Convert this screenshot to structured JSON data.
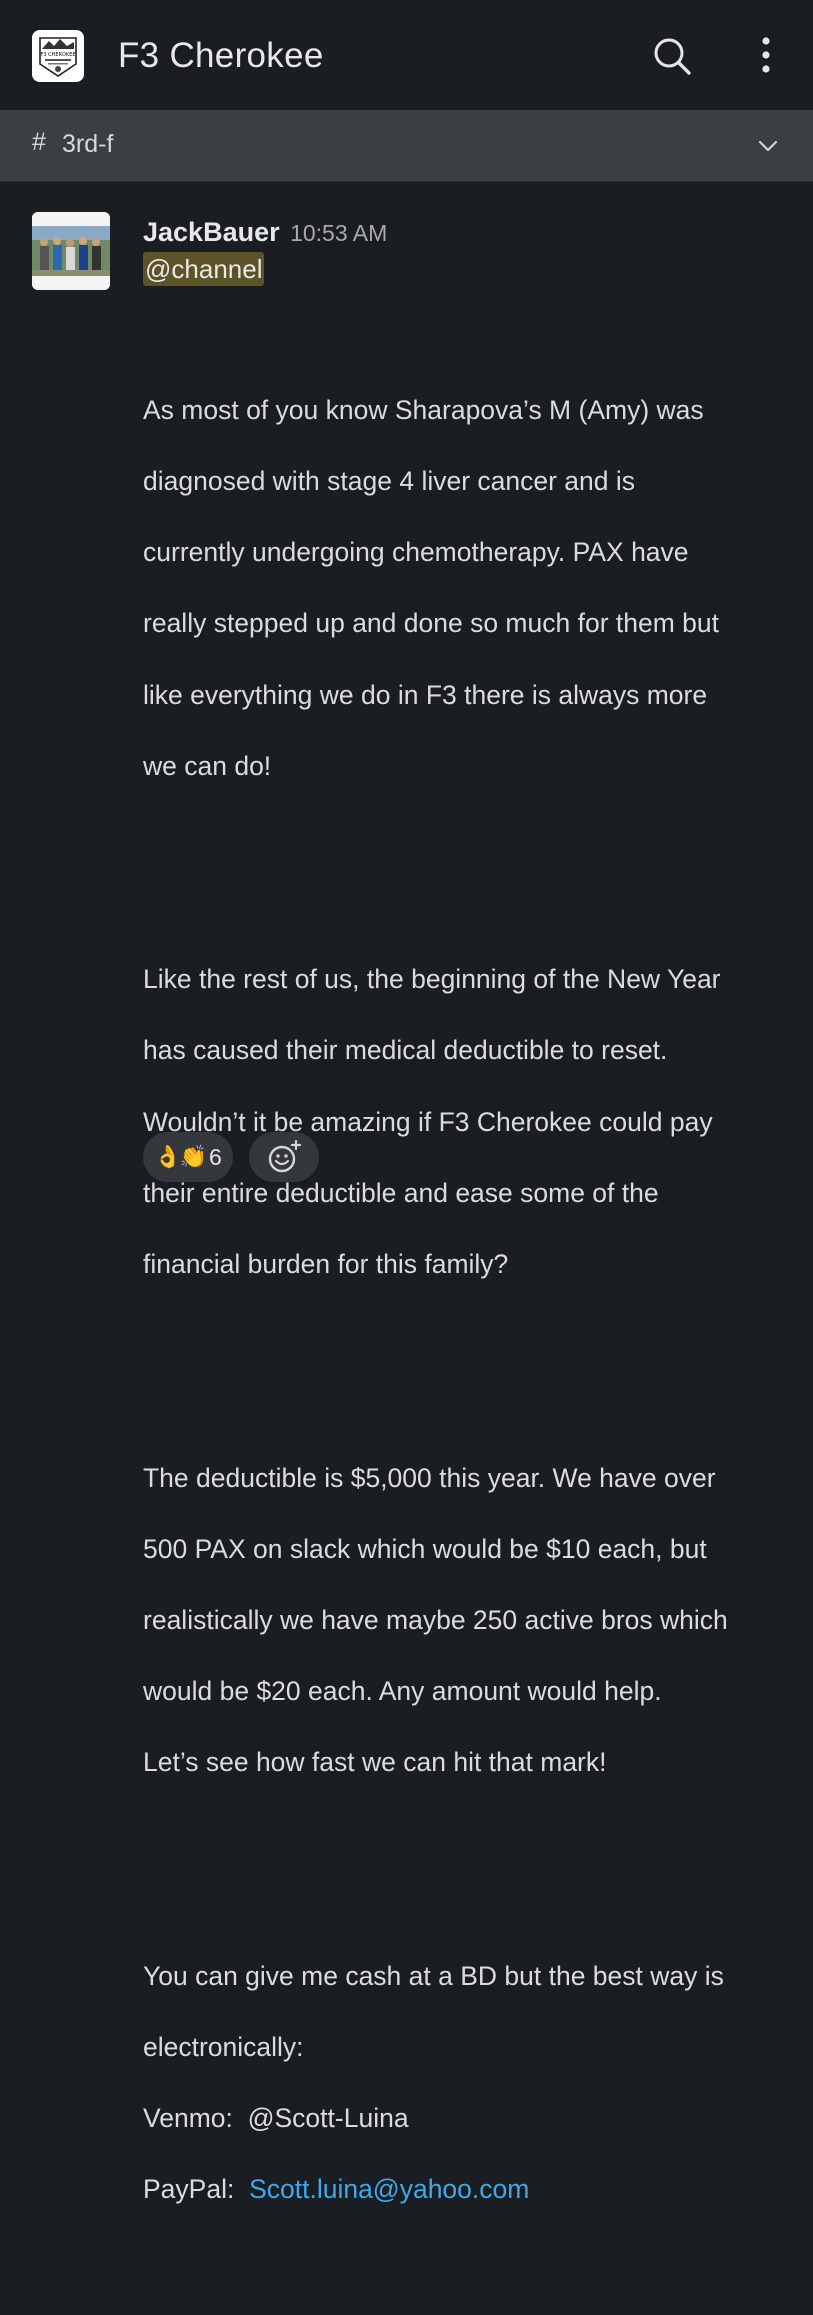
{
  "app": {
    "workspace_title": "F3 Cherokee",
    "logo_text": "F3 CHEROKEE"
  },
  "channel": {
    "hash": "#",
    "name": "3rd-f"
  },
  "message": {
    "sender": "JackBauer",
    "time": "10:53 AM",
    "mention": "@channel",
    "paragraphs": [
      [
        "As most of you know Sharapova’s M (Amy) was",
        "diagnosed with stage 4 liver cancer and is",
        "currently undergoing chemotherapy.  PAX have",
        "really stepped up and done so much for them but",
        "like everything we do in F3 there is always more",
        "we can do!"
      ],
      [
        "Like the rest of us, the beginning of the New Year",
        "has caused their medical deductible to reset.",
        "Wouldn’t it be amazing if F3 Cherokee could pay",
        "their entire deductible and ease some of the",
        "financial burden for this family?"
      ],
      [
        "The deductible is $5,000 this year.  We have over",
        "500 PAX on slack which would be $10 each, but",
        "realistically we have maybe 250 active bros which",
        "would be $20 each.  Any amount would help.",
        "Let’s see how fast we can hit that mark!"
      ],
      [
        "You can give me cash at a BD but the best way is",
        "electronically:"
      ]
    ],
    "venmo_label": "Venmo:",
    "venmo_handle": "@Scott-Luina",
    "paypal_label": "PayPal:",
    "paypal_email": "Scott.luina@yahoo.com"
  },
  "reactions": [
    {
      "emoji": "👌👏",
      "count": "6"
    }
  ],
  "colors": {
    "background": "#1a1d21",
    "channel_bar": "#3b3e43",
    "mention_highlight": "#5c5428",
    "link": "#40a8e8"
  }
}
